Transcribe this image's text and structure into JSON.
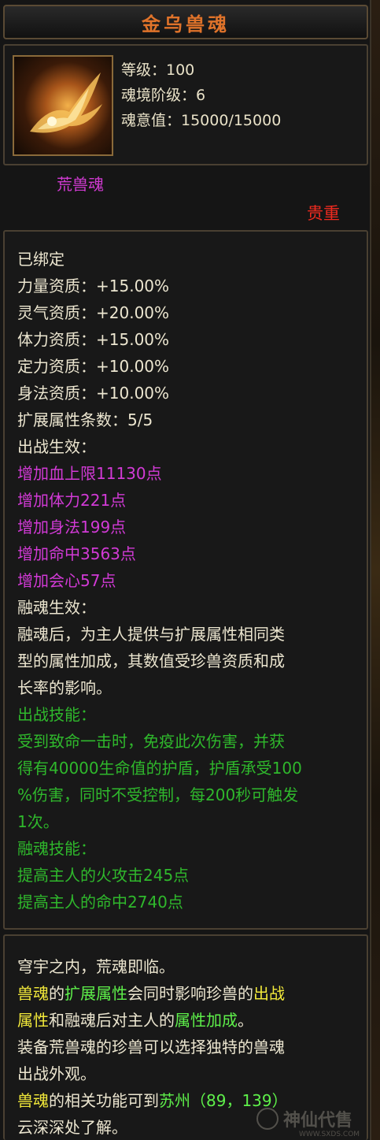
{
  "title": "金乌兽魂",
  "header": {
    "level": "等级：100",
    "realm_tier": "魂境阶级：6",
    "soul_value": "魂意值：15000/15000"
  },
  "type_label": "荒兽魂",
  "rarity": "贵重",
  "attributes": {
    "bound": "已绑定",
    "strength": "力量资质：+15.00%",
    "spirit": "灵气资质：+20.00%",
    "stamina": "体力资质：+15.00%",
    "focus": "定力资质：+10.00%",
    "agility": "身法资质：+10.00%",
    "ext_count": "扩展属性条数：5/5",
    "battle_effect_title": "出战生效：",
    "battle_effects": [
      "增加血上限11130点",
      "增加体力221点",
      "增加身法199点",
      "增加命中3563点",
      "增加会心57点"
    ],
    "fuse_effect_title": "融魂生效：",
    "fuse_effect_desc": [
      "融魂后，为主人提供与扩展属性相同类",
      "型的属性加成，其数值受珍兽资质和成",
      "长率的影响。"
    ],
    "battle_skill_title": "出战技能：",
    "battle_skill_desc": [
      "受到致命一击时，免疫此次伤害，并获",
      "得有40000生命值的护盾，护盾承受100",
      "%伤害，同时不受控制，每200秒可触发",
      "1次。"
    ],
    "fuse_skill_title": "融魂技能：",
    "fuse_skills": [
      "提高主人的火攻击245点",
      "提高主人的命中2740点"
    ]
  },
  "description": {
    "line1": "穹宇之内，荒魂即临。",
    "l2_a": "兽魂",
    "l2_b": "的",
    "l2_c": "扩展属性",
    "l2_d": "会同时影响珍兽的",
    "l2_e": "出战",
    "l3_a": "属性",
    "l3_b": "和融魂后对主人的",
    "l3_c": "属性加成",
    "l3_d": "。",
    "line4": "装备荒兽魂的珍兽可以选择独特的兽魂",
    "line5": "出战外观。",
    "l6_a": "兽魂",
    "l6_b": "的相关功能可到",
    "l6_c": "苏州（89，139）",
    "line7": "云深深处了解。"
  },
  "watermark": {
    "text": "神仙代售",
    "url": "WWW.SXDS.COM"
  },
  "colors": {
    "title": "#e0732a",
    "purple": "#d23ad6",
    "green": "#2fb82c",
    "rarity": "#ee2a1f",
    "highlight_yellow": "#f2e93a",
    "highlight_green": "#5ef04a"
  }
}
